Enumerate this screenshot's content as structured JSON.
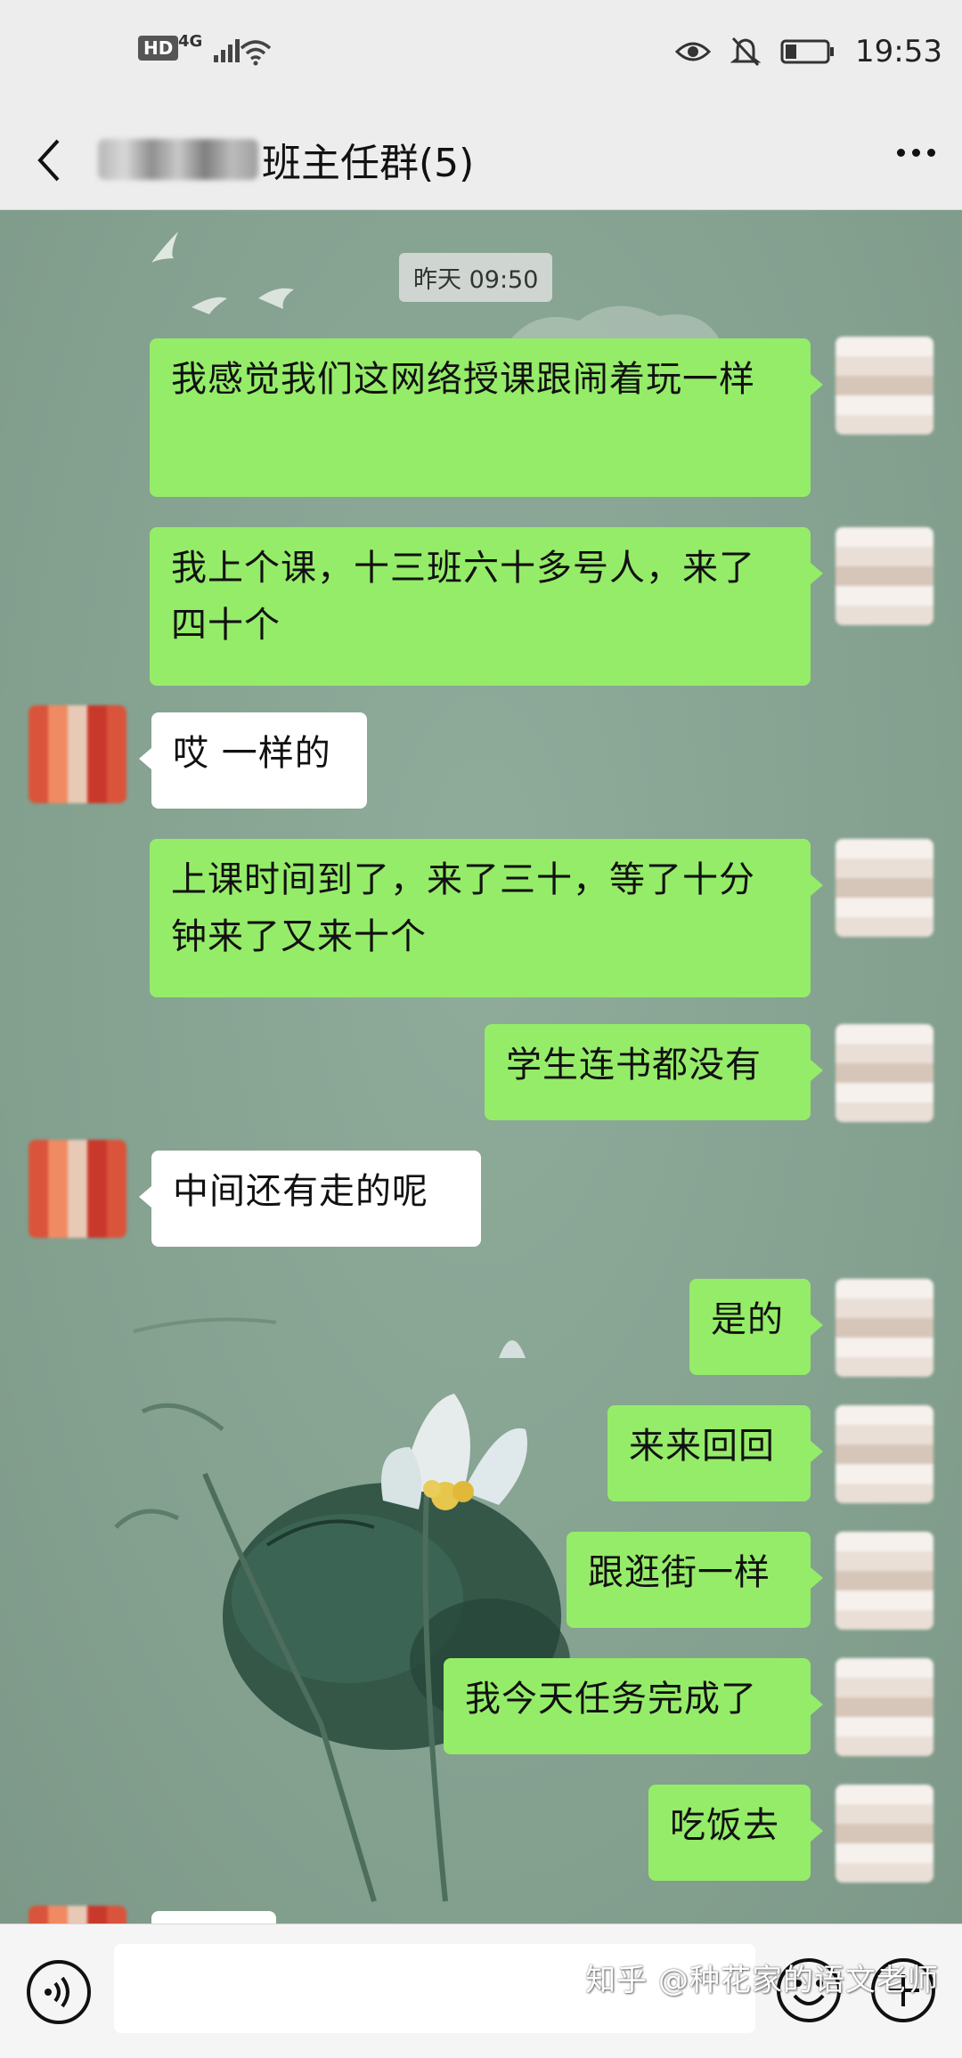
{
  "status_bar": {
    "hd": "HD",
    "network": "4G",
    "time": "19:53",
    "icons": [
      "signal-icon",
      "wifi-icon",
      "eye-icon",
      "mute-bell-icon",
      "battery-icon"
    ]
  },
  "header": {
    "title_visible": "班主任群(5)",
    "back_icon": "back-arrow-icon",
    "more_icon": "more-dots-icon"
  },
  "chat": {
    "timestamp": "昨天 09:50",
    "messages": [
      {
        "side": "me",
        "text": "我感觉我们这网络授课跟闹着玩一样"
      },
      {
        "side": "me",
        "text": "我上个课，十三班六十多号人，来了四十个"
      },
      {
        "side": "other",
        "text": "哎 一样的"
      },
      {
        "side": "me",
        "text": "上课时间到了，来了三十，等了十分钟来了又来十个"
      },
      {
        "side": "me",
        "text": "学生连书都没有"
      },
      {
        "side": "other",
        "text": "中间还有走的呢"
      },
      {
        "side": "me",
        "text": "是的"
      },
      {
        "side": "me",
        "text": "来来回回"
      },
      {
        "side": "me",
        "text": "跟逛街一样"
      },
      {
        "side": "me",
        "text": "我今天任务完成了"
      },
      {
        "side": "me",
        "text": "吃饭去"
      }
    ]
  },
  "input_bar": {
    "voice_icon": "voice-icon",
    "emoji_icon": "emoji-icon",
    "plus_icon": "plus-icon"
  },
  "watermark": "知乎 @种花家的语文老师",
  "colors": {
    "my_bubble": "#95ec69",
    "other_bubble": "#ffffff",
    "chat_background": "#86a392",
    "bar_background": "#ededed"
  }
}
